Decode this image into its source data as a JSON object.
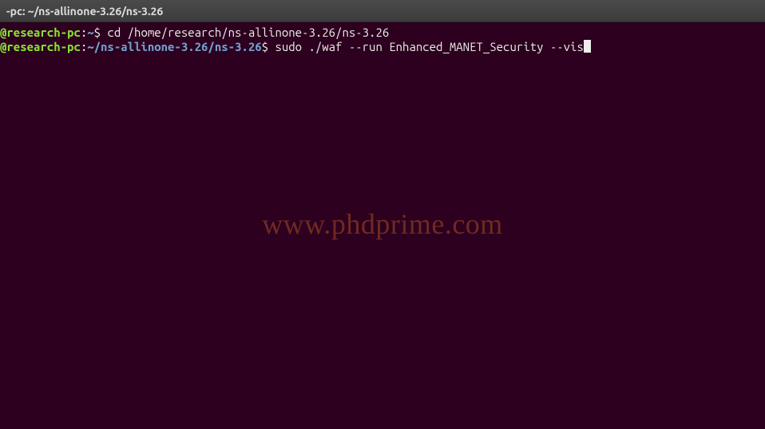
{
  "titlebar": {
    "text": "-pc: ~/ns-allinone-3.26/ns-3.26"
  },
  "terminal": {
    "lines": [
      {
        "userhost": "@research-pc",
        "colon": ":",
        "path": "~",
        "dollar": "$ ",
        "command": "cd /home/research/ns-allinone-3.26/ns-3.26",
        "cursor": false
      },
      {
        "userhost": "@research-pc",
        "colon": ":",
        "path": "~/ns-allinone-3.26/ns-3.26",
        "dollar": "$ ",
        "command": "sudo ./waf --run Enhanced_MANET_Security --vis",
        "cursor": true
      }
    ]
  },
  "watermark": {
    "text": "www.phdprime.com"
  }
}
